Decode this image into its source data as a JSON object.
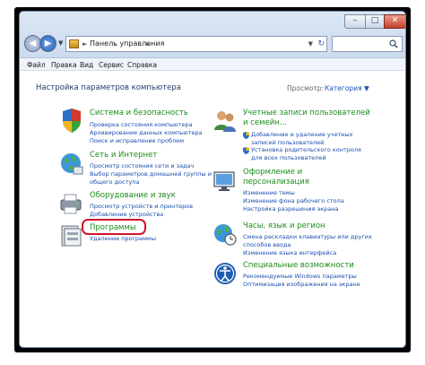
{
  "window": {
    "minimize_glyph": "–",
    "maximize_glyph": "□",
    "close_glyph": "✕"
  },
  "navigation": {
    "back_glyph": "◀",
    "forward_glyph": "▶",
    "address_separator": "►",
    "address_text": "Панель управления",
    "address_dropdown_glyph": "▼",
    "refresh_glyph": "↻"
  },
  "menu": {
    "items": [
      "Файл",
      "Правка",
      "Вид",
      "Сервис",
      "Справка"
    ]
  },
  "page": {
    "title": "Настройка параметров компьютера",
    "view_label": "Просмотр:",
    "view_value": "Категория ▼"
  },
  "categories": {
    "security": {
      "title": "Система и безопасность",
      "links": [
        "Проверка состояния компьютера",
        "Архивирование данных компьютера",
        "Поиск и исправление проблем"
      ]
    },
    "network": {
      "title": "Сеть и Интернет",
      "links": [
        "Просмотр состояния сети и задач",
        "Выбор параметров домашней группы и",
        "общего доступа"
      ]
    },
    "hardware": {
      "title": "Оборудование и звук",
      "links": [
        "Просмотр устройств и принтеров",
        "Добавление устройства"
      ]
    },
    "programs": {
      "title": "Программы",
      "links": [
        "Удаление программы"
      ]
    },
    "users": {
      "title_line1": "Учетные записи пользователей",
      "title_line2": "и семейн...",
      "links": [
        "Добавление и удаление учетных",
        "записей пользователей",
        "Установка родительского контроля",
        "для всех пользователей"
      ]
    },
    "appearance": {
      "title_line1": "Оформление и",
      "title_line2": "персонализация",
      "links": [
        "Изменение темы",
        "Изменение фона рабочего стола",
        "Настройка разрешения экрана"
      ]
    },
    "clock": {
      "title": "Часы, язык и регион",
      "links": [
        "Смена раскладки клавиатуры или других",
        "способов ввода",
        "Изменение языка интерфейса"
      ]
    },
    "access": {
      "title": "Специальные возможности",
      "links": [
        "Рекомендуемые Windows параметры",
        "Оптимизация изображения на экране"
      ]
    }
  },
  "colors": {
    "category_title": "#1a8c1a",
    "link": "#1a4fae",
    "highlight_border": "#d3132a"
  }
}
